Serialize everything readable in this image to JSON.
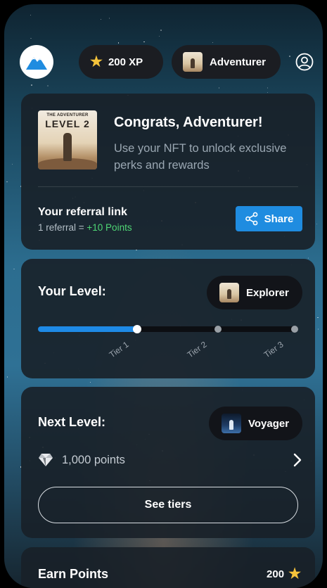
{
  "header": {
    "xp": "200 XP",
    "rank": "Adventurer",
    "rank_thumb_text": "LEVEL 2"
  },
  "congrats": {
    "nft_caption": "THE ADVENTURER",
    "nft_level": "LEVEL 2",
    "title": "Congrats, Adventurer!",
    "subtitle": "Use your NFT to unlock exclusive perks and rewards",
    "referral_title": "Your referral link",
    "referral_prefix": "1 referral = ",
    "referral_reward": "+10 Points",
    "share_label": "Share"
  },
  "level": {
    "title": "Your Level:",
    "badge": "Explorer",
    "progress_fraction": 0.38,
    "tiers": [
      "Tier 1",
      "Tier 2",
      "Tier 3"
    ]
  },
  "next_level": {
    "title": "Next Level:",
    "badge": "Voyager",
    "points": "1,000 points",
    "see_tiers_label": "See tiers"
  },
  "earn": {
    "title": "Earn Points",
    "amount": "200"
  },
  "colors": {
    "accent_blue": "#1f8ce0",
    "reward_green": "#4fd675",
    "star_gold": "#f5c33b"
  }
}
